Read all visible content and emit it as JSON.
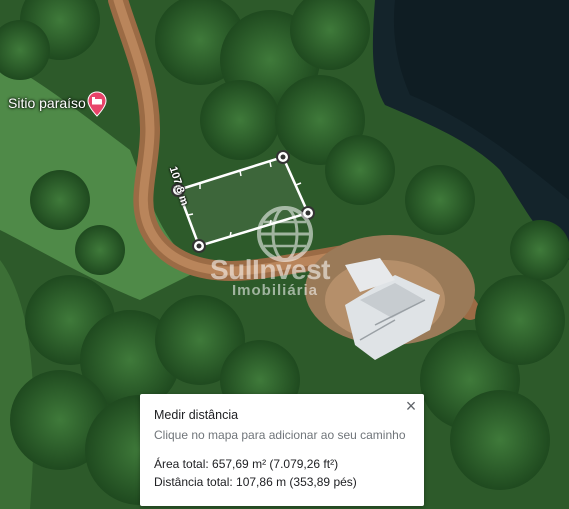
{
  "map": {
    "place_label": "Sitio paraíso",
    "place_icon": "hotel-bed-icon",
    "measure_label": "107,8 m",
    "watermark_brand": "SulInvest",
    "watermark_sub": "Imobiliária"
  },
  "panel": {
    "title": "Medir distância",
    "hint": "Clique no mapa para adicionar ao seu caminho",
    "area_text": "Área total: 657,69 m² (7.079,26 ft²)",
    "distance_text": "Distância total: 107,86 m (353,89 pés)",
    "close_label": "×"
  },
  "colors": {
    "pin": "#e8446a",
    "measure_line": "#ffffff",
    "panel_bg": "#ffffff"
  }
}
